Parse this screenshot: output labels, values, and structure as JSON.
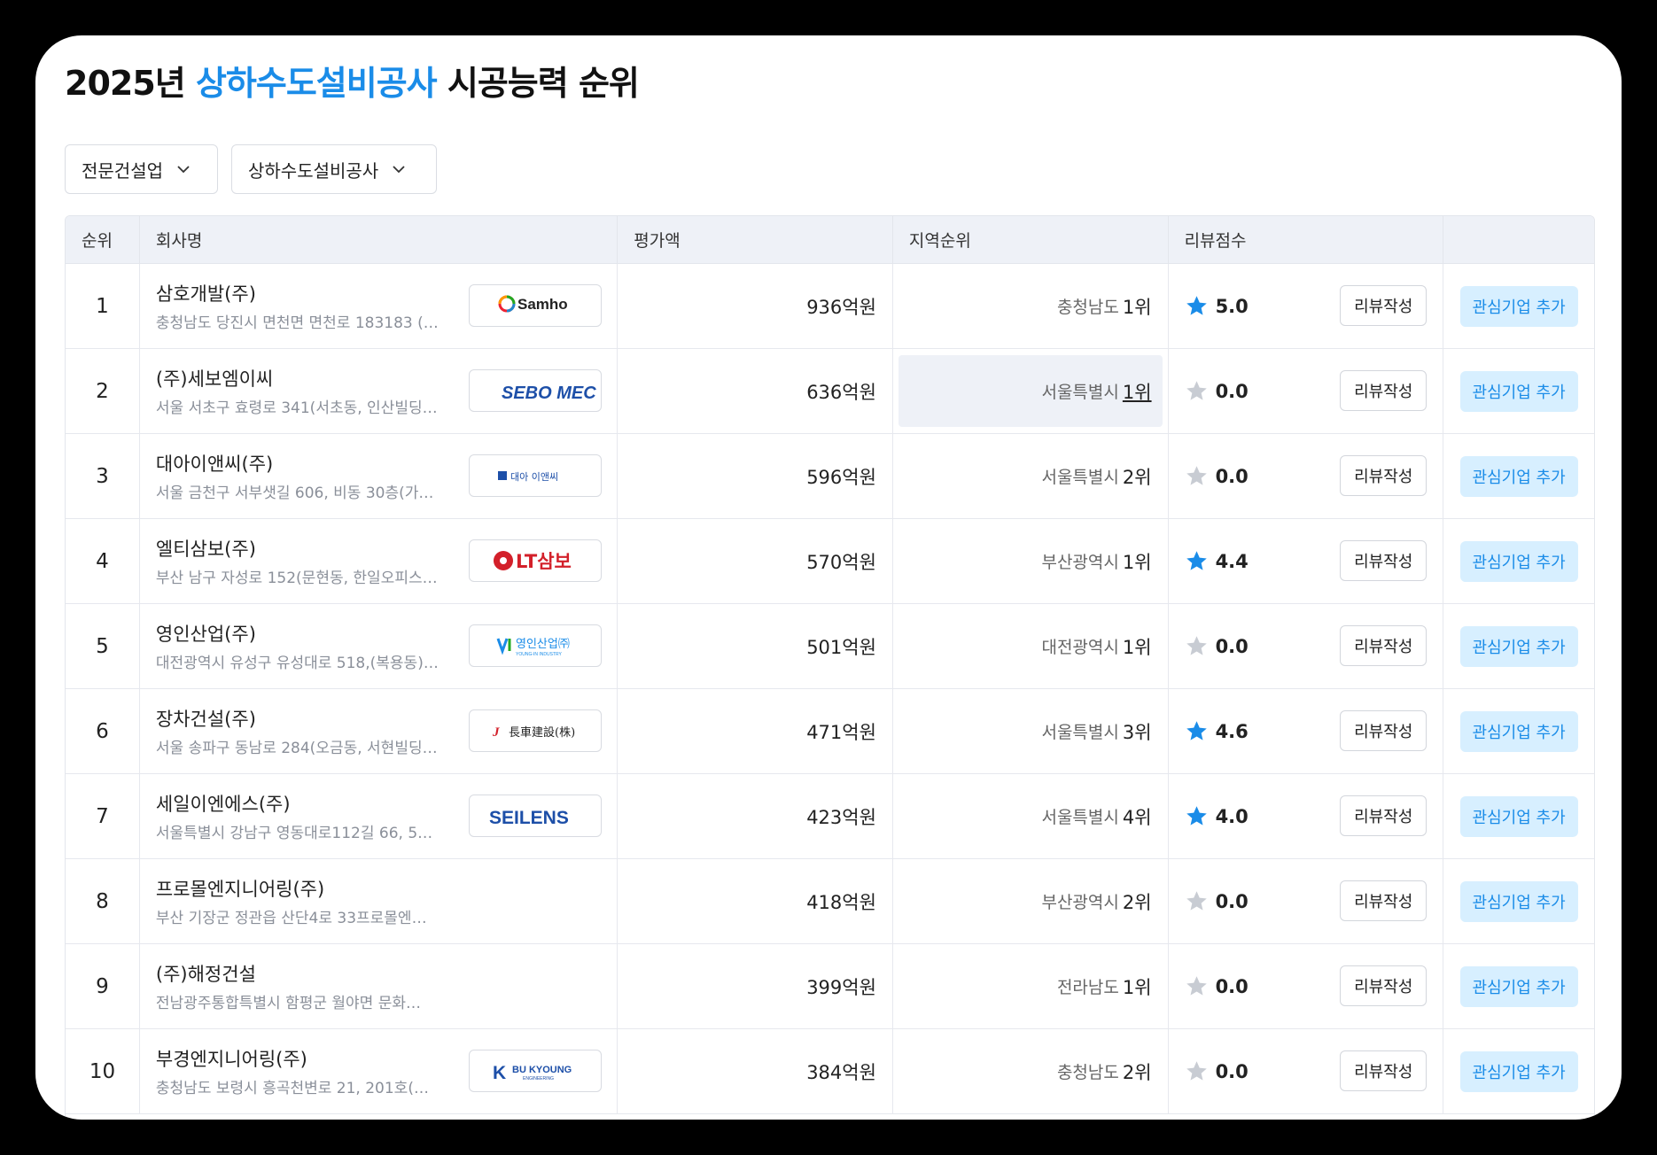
{
  "title": {
    "year": "2025년 ",
    "highlight": "상하수도설비공사",
    "suffix": " 시공능력 순위"
  },
  "filters": [
    {
      "label": "전문건설업"
    },
    {
      "label": "상하수도설비공사"
    }
  ],
  "table": {
    "headers": {
      "rank": "순위",
      "company": "회사명",
      "amount": "평가액",
      "region": "지역순위",
      "review": "리뷰점수",
      "action": ""
    },
    "write_review_label": "리뷰작성",
    "add_favorite_label": "관심기업 추가",
    "rows": [
      {
        "rank": "1",
        "name": "삼호개발(주)",
        "address": "충청남도 당진시 면천면 면천로 183183 (…",
        "logo": "Samho",
        "amount": "936억원",
        "region": "충청남도",
        "region_rank": "1위",
        "score": "5.0",
        "star_filled": true
      },
      {
        "rank": "2",
        "name": "(주)세보엠이씨",
        "address": "서울 서초구 효령로 341(서초동, 인산빌딩…",
        "logo": "SEBO MEC",
        "amount": "636억원",
        "region": "서울특별시",
        "region_rank": "1위",
        "score": "0.0",
        "star_filled": false
      },
      {
        "rank": "3",
        "name": "대아이앤씨(주)",
        "address": "서울 금천구 서부샛길 606, 비동 30층(가…",
        "logo": "대아 이앤씨",
        "amount": "596억원",
        "region": "서울특별시",
        "region_rank": "2위",
        "score": "0.0",
        "star_filled": false
      },
      {
        "rank": "4",
        "name": "엘티삼보(주)",
        "address": "부산 남구 자성로 152(문현동, 한일오피스…",
        "logo": "LT삼보",
        "amount": "570억원",
        "region": "부산광역시",
        "region_rank": "1위",
        "score": "4.4",
        "star_filled": true
      },
      {
        "rank": "5",
        "name": "영인산업(주)",
        "address": "대전광역시 유성구 유성대로 518,(복용동)…",
        "logo": "영인산업㈜",
        "logo_sub": "YOUNG-IN INDUSTRY",
        "amount": "501억원",
        "region": "대전광역시",
        "region_rank": "1위",
        "score": "0.0",
        "star_filled": false
      },
      {
        "rank": "6",
        "name": "장차건설(주)",
        "address": "서울 송파구 동남로 284(오금동, 서현빌딩…",
        "logo": "長車建設(株)",
        "amount": "471억원",
        "region": "서울특별시",
        "region_rank": "3위",
        "score": "4.6",
        "star_filled": true
      },
      {
        "rank": "7",
        "name": "세일이엔에스(주)",
        "address": "서울특별시 강남구 영동대로112길 66, 5…",
        "logo": "SEILENS",
        "amount": "423억원",
        "region": "서울특별시",
        "region_rank": "4위",
        "score": "4.0",
        "star_filled": true
      },
      {
        "rank": "8",
        "name": "프로몰엔지니어링(주)",
        "address": "부산 기장군 정관읍 산단4로 33프로몰엔…",
        "logo": "",
        "amount": "418억원",
        "region": "부산광역시",
        "region_rank": "2위",
        "score": "0.0",
        "star_filled": false
      },
      {
        "rank": "9",
        "name": "(주)해정건설",
        "address": "전남광주통합특별시 함평군 월야면 문화…",
        "logo": "",
        "amount": "399억원",
        "region": "전라남도",
        "region_rank": "1위",
        "score": "0.0",
        "star_filled": false
      },
      {
        "rank": "10",
        "name": "부경엔지니어링(주)",
        "address": "충청남도 보령시 흥곡천변로 21, 201호(…",
        "logo": "BU KYOUNG",
        "logo_sub": "ENGINEERING",
        "amount": "384억원",
        "region": "충청남도",
        "region_rank": "2위",
        "score": "0.0",
        "star_filled": false
      }
    ]
  },
  "colors": {
    "accent": "#1a8ce8",
    "star_filled": "#1a8ce8",
    "star_empty": "#c8ccd3",
    "header_bg": "#eef1f7",
    "fav_bg": "#d7efff"
  }
}
